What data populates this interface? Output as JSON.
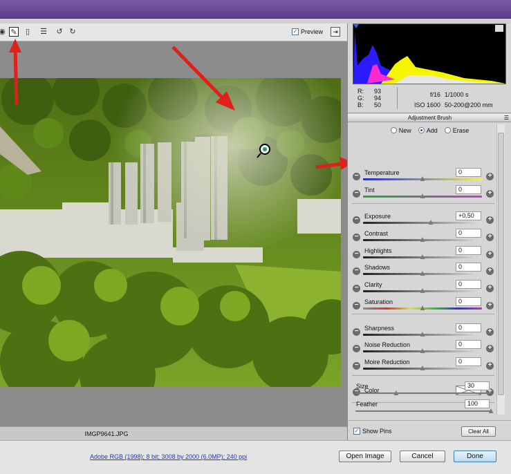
{
  "toolbar": {
    "tools": [
      {
        "name": "red-eye-tool",
        "glyph": "◉"
      },
      {
        "name": "adjustment-brush-tool",
        "glyph": "✎"
      },
      {
        "name": "graduated-filter-tool",
        "glyph": "▯"
      },
      {
        "name": "preferences-tool",
        "glyph": "☰"
      },
      {
        "name": "rotate-left-tool",
        "glyph": "↺"
      },
      {
        "name": "rotate-right-tool",
        "glyph": "↻"
      }
    ],
    "preview_label": "Preview",
    "preview_checked": true
  },
  "image": {
    "filename": "IMGP9641.JPG"
  },
  "info": {
    "r_label": "R:",
    "r": "93",
    "g_label": "G:",
    "g": "94",
    "b_label": "B:",
    "b": "50",
    "aperture": "f/16",
    "shutter": "1/1000 s",
    "iso": "ISO 1600",
    "lens": "50-200@200 mm"
  },
  "panel": {
    "title": "Adjustment Brush",
    "modes": [
      "New",
      "Add",
      "Erase"
    ],
    "selected_mode": "Add",
    "adjustments": [
      {
        "label": "Temperature",
        "value": "0",
        "pos": 0.5,
        "track": "temp"
      },
      {
        "label": "Tint",
        "value": "0",
        "pos": 0.5,
        "track": "tint"
      },
      {
        "label": "Exposure",
        "value": "+0.50",
        "pos": 0.57,
        "track": "gray"
      },
      {
        "label": "Contrast",
        "value": "0",
        "pos": 0.5,
        "track": "gray"
      },
      {
        "label": "Highlights",
        "value": "0",
        "pos": 0.5,
        "track": "gray"
      },
      {
        "label": "Shadows",
        "value": "0",
        "pos": 0.5,
        "track": "gray"
      },
      {
        "label": "Clarity",
        "value": "0",
        "pos": 0.5,
        "track": "gray"
      },
      {
        "label": "Saturation",
        "value": "0",
        "pos": 0.5,
        "track": "sat"
      },
      {
        "label": "Sharpness",
        "value": "0",
        "pos": 0.5,
        "track": "gray"
      },
      {
        "label": "Noise Reduction",
        "value": "0",
        "pos": 0.5,
        "track": "gray"
      },
      {
        "label": "Moire Reduction",
        "value": "0",
        "pos": 0.5,
        "track": "gray"
      }
    ],
    "color_label": "Color",
    "size_label": "Size",
    "size_value": "30",
    "size_pos": 0.3,
    "feather_label": "Feather",
    "feather_value": "100",
    "feather_pos": 1.0,
    "show_pins_label": "Show Pins",
    "show_pins_checked": true,
    "clear_all_label": "Clear All"
  },
  "footer": {
    "workflow_link": "Adobe RGB (1998); 8 bit; 3008 by 2000 (6.0MP); 240 ppi",
    "open_image": "Open Image",
    "cancel": "Cancel",
    "done": "Done"
  },
  "colors": {
    "accent_arrow": "#e0201a",
    "panel_bg": "#d6d6d6",
    "link": "#1c3ab5"
  }
}
